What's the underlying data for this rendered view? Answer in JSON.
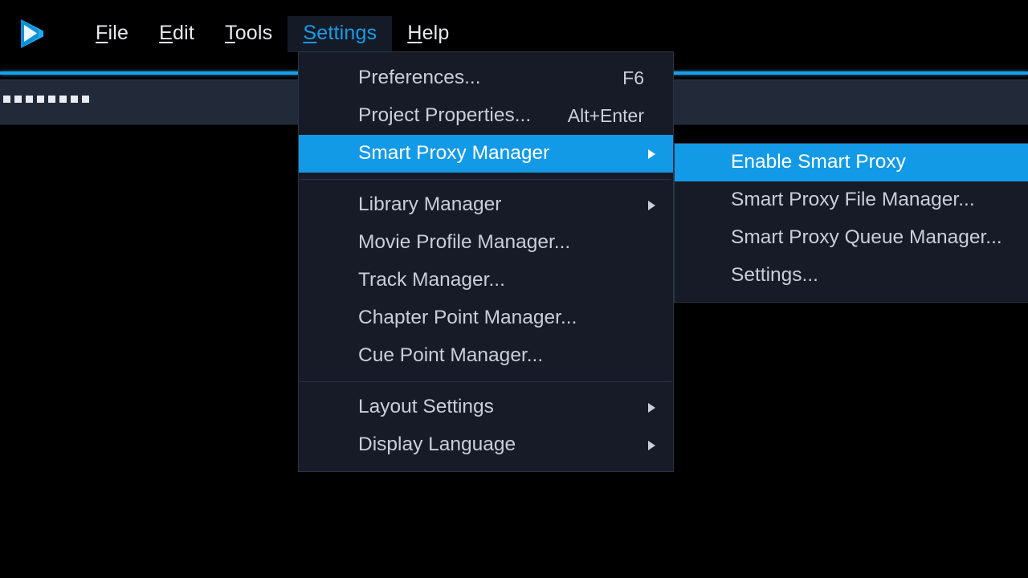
{
  "app": {
    "logo_icon": "play-triangle-logo",
    "logo_color": "#16a5e8",
    "accent_color": "#1c9ee6",
    "highlight_color": "#139ae6",
    "menu_bg_color": "#161b27",
    "toolbar_bg_color": "#222a3a",
    "canvas_color": "#000000"
  },
  "menubar": {
    "items": [
      {
        "label": "File",
        "mnemonic": "F",
        "rest": "ile",
        "open": false
      },
      {
        "label": "Edit",
        "mnemonic": "E",
        "rest": "dit",
        "open": false
      },
      {
        "label": "Tools",
        "mnemonic": "T",
        "rest": "ools",
        "open": false
      },
      {
        "label": "Settings",
        "mnemonic": "S",
        "rest": "ettings",
        "open": true
      },
      {
        "label": "Help",
        "mnemonic": "H",
        "rest": "elp",
        "open": false
      }
    ]
  },
  "toolbar": {
    "grip_icon": "drag-grip-icon",
    "grip_dots": 8
  },
  "settings_menu": {
    "title": "Settings",
    "items": [
      {
        "type": "item",
        "label": "Preferences...",
        "accel": "F6",
        "arrow": false,
        "highlighted": false
      },
      {
        "type": "item",
        "label": "Project Properties...",
        "accel": "Alt+Enter",
        "arrow": false,
        "highlighted": false
      },
      {
        "type": "item",
        "label": "Smart Proxy Manager",
        "accel": "",
        "arrow": true,
        "highlighted": true
      },
      {
        "type": "separator"
      },
      {
        "type": "item",
        "label": "Library Manager",
        "accel": "",
        "arrow": true,
        "highlighted": false
      },
      {
        "type": "item",
        "label": "Movie Profile Manager...",
        "accel": "",
        "arrow": false,
        "highlighted": false
      },
      {
        "type": "item",
        "label": "Track Manager...",
        "accel": "",
        "arrow": false,
        "highlighted": false
      },
      {
        "type": "item",
        "label": "Chapter Point Manager...",
        "accel": "",
        "arrow": false,
        "highlighted": false
      },
      {
        "type": "item",
        "label": "Cue Point Manager...",
        "accel": "",
        "arrow": false,
        "highlighted": false
      },
      {
        "type": "separator"
      },
      {
        "type": "item",
        "label": "Layout Settings",
        "accel": "",
        "arrow": true,
        "highlighted": false
      },
      {
        "type": "item",
        "label": "Display Language",
        "accel": "",
        "arrow": true,
        "highlighted": false
      }
    ]
  },
  "smart_proxy_submenu": {
    "title": "Smart Proxy Manager",
    "items": [
      {
        "type": "item",
        "label": "Enable Smart Proxy",
        "accel": "",
        "arrow": false,
        "highlighted": true
      },
      {
        "type": "item",
        "label": "Smart Proxy File Manager...",
        "accel": "",
        "arrow": false,
        "highlighted": false
      },
      {
        "type": "item",
        "label": "Smart Proxy Queue Manager...",
        "accel": "",
        "arrow": false,
        "highlighted": false
      },
      {
        "type": "item",
        "label": "Settings...",
        "accel": "",
        "arrow": false,
        "highlighted": false
      }
    ]
  }
}
